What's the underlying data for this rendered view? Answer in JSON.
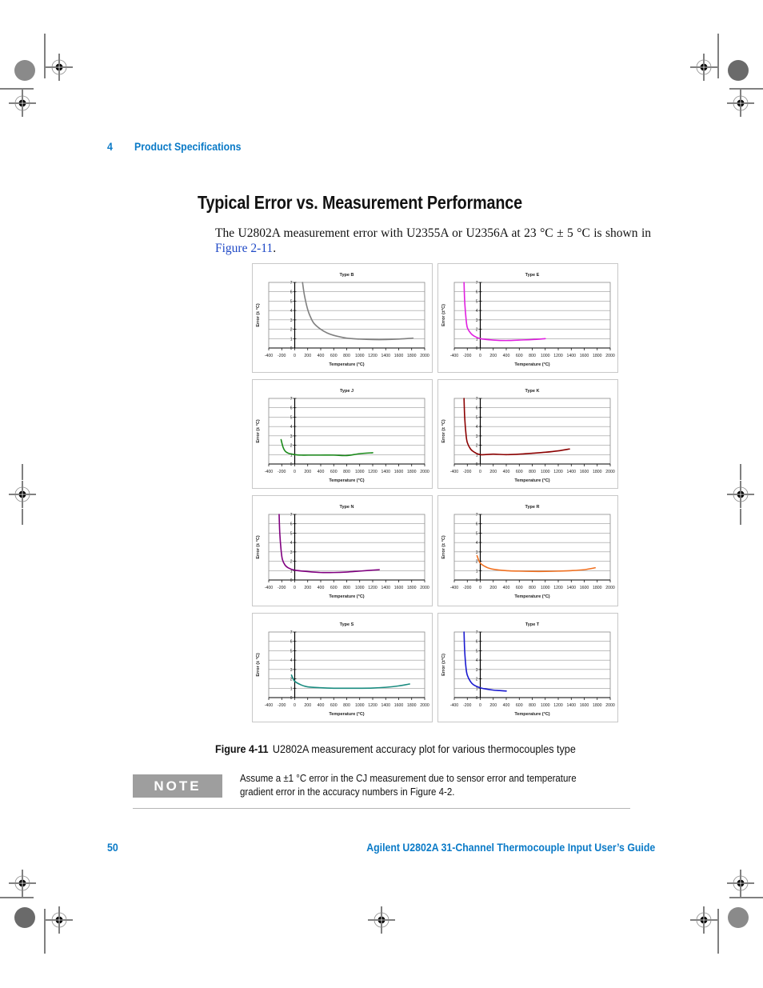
{
  "header": {
    "chapter_number": "4",
    "chapter_title": "Product Specifications"
  },
  "section": {
    "heading": "Typical Error vs. Measurement Performance",
    "body_before_link": "The U2802A measurement error with U2355A or U2356A at 23 °C ± 5 °C is shown in ",
    "body_link": "Figure 2-11",
    "body_after_link": "."
  },
  "figure": {
    "label": "Figure 4-11",
    "caption": "U2802A measurement accuracy plot for various thermocouples type"
  },
  "note": {
    "badge": "NOTE",
    "text": "Assume a ±1 °C error in the CJ measurement due to sensor error and temperature gradient error in the accuracy numbers in Figure 4-2."
  },
  "footer": {
    "page_number": "50",
    "guide_title": "Agilent U2802A 31-Channel Thermocouple Input User’s Guide"
  },
  "colors": {
    "brand_blue": "#0a7ac7",
    "link_blue": "#1f49c6",
    "note_gray": "#9e9e9e"
  },
  "chart_data": [
    {
      "type": "line",
      "title": "Type B",
      "xlabel": "Temperature (°C)",
      "ylabel": "Error (± °C)",
      "xlim": [
        -400,
        2000
      ],
      "ylim": [
        0,
        7
      ],
      "grid": true,
      "color": "#808080",
      "x_ticks": [
        -400,
        -200,
        0,
        200,
        400,
        600,
        800,
        1000,
        1200,
        1400,
        1600,
        1800,
        2000
      ],
      "y_ticks": [
        0,
        1,
        2,
        3,
        4,
        5,
        6,
        7
      ],
      "x": [
        120,
        150,
        200,
        250,
        300,
        400,
        500,
        600,
        800,
        1000,
        1200,
        1400,
        1600,
        1820
      ],
      "y": [
        7.0,
        5.6,
        4.1,
        3.2,
        2.6,
        2.0,
        1.6,
        1.35,
        1.05,
        0.95,
        0.9,
        0.9,
        0.95,
        1.05
      ]
    },
    {
      "type": "line",
      "title": "Type E",
      "xlabel": "Temperature (°C)",
      "ylabel": "Error (±°C)",
      "xlim": [
        -400,
        2000
      ],
      "ylim": [
        0,
        7
      ],
      "grid": true,
      "color": "#e020e0",
      "x_ticks": [
        -400,
        -200,
        0,
        200,
        400,
        600,
        800,
        1000,
        1200,
        1400,
        1600,
        1800,
        2000
      ],
      "y_ticks": [
        0,
        1,
        2,
        3,
        4,
        5,
        6,
        7
      ],
      "x": [
        -250,
        -240,
        -220,
        -200,
        -150,
        -100,
        0,
        200,
        400,
        600,
        800,
        1000
      ],
      "y": [
        7.0,
        5.0,
        3.2,
        2.2,
        1.6,
        1.3,
        1.0,
        0.85,
        0.8,
        0.85,
        0.9,
        1.0
      ]
    },
    {
      "type": "line",
      "title": "Type J",
      "xlabel": "Temperature (°C)",
      "ylabel": "Error (± °C)",
      "xlim": [
        -400,
        2000
      ],
      "ylim": [
        0,
        7
      ],
      "grid": true,
      "color": "#1a8a1a",
      "x_ticks": [
        -400,
        -200,
        0,
        200,
        400,
        600,
        800,
        1000,
        1200,
        1400,
        1600,
        1800,
        2000
      ],
      "y_ticks": [
        0,
        1,
        2,
        3,
        4,
        5,
        6,
        7
      ],
      "x": [
        -210,
        -180,
        -150,
        -100,
        0,
        100,
        200,
        400,
        600,
        800,
        1000,
        1200
      ],
      "y": [
        2.6,
        1.8,
        1.4,
        1.15,
        1.0,
        0.95,
        0.95,
        0.95,
        0.95,
        0.9,
        1.1,
        1.2
      ]
    },
    {
      "type": "line",
      "title": "Type K",
      "xlabel": "Temperature (°C)",
      "ylabel": "Error (± °C)",
      "xlim": [
        -400,
        2000
      ],
      "ylim": [
        0,
        7
      ],
      "grid": true,
      "color": "#8b0000",
      "x_ticks": [
        -400,
        -200,
        0,
        200,
        400,
        600,
        800,
        1000,
        1200,
        1400,
        1600,
        1800,
        2000
      ],
      "y_ticks": [
        0,
        1,
        2,
        3,
        4,
        5,
        6,
        7
      ],
      "x": [
        -250,
        -240,
        -220,
        -200,
        -150,
        -100,
        0,
        200,
        400,
        600,
        800,
        1000,
        1200,
        1372
      ],
      "y": [
        7.0,
        5.0,
        3.2,
        2.3,
        1.6,
        1.3,
        1.0,
        1.05,
        1.0,
        1.05,
        1.15,
        1.25,
        1.4,
        1.6
      ]
    },
    {
      "type": "line",
      "title": "Type N",
      "xlabel": "Temperature (°C)",
      "ylabel": "Error (± °C)",
      "xlim": [
        -400,
        2000
      ],
      "ylim": [
        0,
        7
      ],
      "grid": true,
      "color": "#800080",
      "x_ticks": [
        -400,
        -200,
        0,
        200,
        400,
        600,
        800,
        1000,
        1200,
        1400,
        1600,
        1800,
        2000
      ],
      "y_ticks": [
        0,
        1,
        2,
        3,
        4,
        5,
        6,
        7
      ],
      "x": [
        -240,
        -230,
        -210,
        -190,
        -150,
        -100,
        0,
        200,
        400,
        600,
        800,
        1000,
        1300
      ],
      "y": [
        7.0,
        5.0,
        3.2,
        2.2,
        1.6,
        1.3,
        1.05,
        0.9,
        0.8,
        0.8,
        0.85,
        0.95,
        1.1
      ]
    },
    {
      "type": "line",
      "title": "Type R",
      "xlabel": "Temperature (°C)",
      "ylabel": "Error (± °C)",
      "xlim": [
        -400,
        2000
      ],
      "ylim": [
        0,
        7
      ],
      "grid": true,
      "color": "#f07020",
      "x_ticks": [
        -400,
        -200,
        0,
        200,
        400,
        600,
        800,
        1000,
        1200,
        1400,
        1600,
        1800,
        2000
      ],
      "y_ticks": [
        0,
        1,
        2,
        3,
        4,
        5,
        6,
        7
      ],
      "x": [
        -50,
        0,
        100,
        200,
        400,
        600,
        800,
        1000,
        1200,
        1400,
        1600,
        1768
      ],
      "y": [
        2.6,
        1.8,
        1.35,
        1.15,
        1.0,
        0.95,
        0.92,
        0.92,
        0.95,
        1.0,
        1.1,
        1.3
      ]
    },
    {
      "type": "line",
      "title": "Type S",
      "xlabel": "Temperature (°C)",
      "ylabel": "Error (± °C)",
      "xlim": [
        -400,
        2000
      ],
      "ylim": [
        0,
        7
      ],
      "grid": true,
      "color": "#1a8c80",
      "x_ticks": [
        -400,
        -200,
        0,
        200,
        400,
        600,
        800,
        1000,
        1200,
        1400,
        1600,
        1800,
        2000
      ],
      "y_ticks": [
        0,
        1,
        2,
        3,
        4,
        5,
        6,
        7
      ],
      "x": [
        -50,
        0,
        100,
        200,
        400,
        600,
        800,
        1000,
        1200,
        1400,
        1600,
        1768
      ],
      "y": [
        2.4,
        1.75,
        1.35,
        1.15,
        1.05,
        1.0,
        1.0,
        1.0,
        1.02,
        1.1,
        1.25,
        1.45
      ]
    },
    {
      "type": "line",
      "title": "Type T",
      "xlabel": "Temperature (°C)",
      "ylabel": "Error (±°C)",
      "xlim": [
        -400,
        2000
      ],
      "ylim": [
        0,
        7
      ],
      "grid": true,
      "color": "#1a1ad0",
      "x_ticks": [
        -400,
        -200,
        0,
        200,
        400,
        600,
        800,
        1000,
        1200,
        1400,
        1600,
        1800,
        2000
      ],
      "y_ticks": [
        0,
        1,
        2,
        3,
        4,
        5,
        6,
        7
      ],
      "x": [
        -250,
        -240,
        -220,
        -200,
        -150,
        -100,
        0,
        100,
        200,
        300,
        400
      ],
      "y": [
        7.0,
        5.0,
        3.2,
        2.4,
        1.7,
        1.35,
        1.05,
        0.9,
        0.8,
        0.75,
        0.7
      ]
    }
  ]
}
